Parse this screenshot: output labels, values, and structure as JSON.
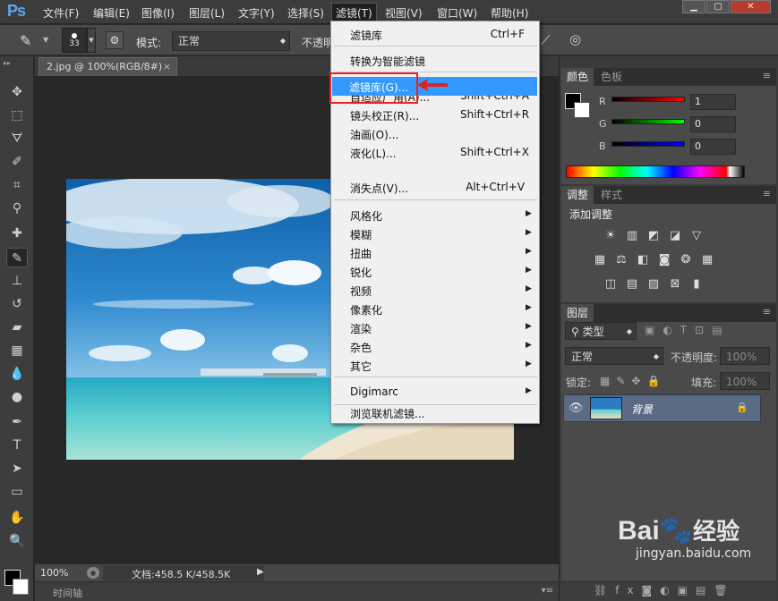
{
  "app": {
    "logo": "Ps"
  },
  "menubar": {
    "items": [
      "文件(F)",
      "编辑(E)",
      "图像(I)",
      "图层(L)",
      "文字(Y)",
      "选择(S)",
      "滤镜(T)",
      "视图(V)",
      "窗口(W)",
      "帮助(H)"
    ],
    "active": "滤镜(T)"
  },
  "options_bar": {
    "brush_size": "33",
    "mode_label": "模式:",
    "mode_value": "正常",
    "opacity_label": "不透明"
  },
  "document": {
    "tab_title": "2.jpg @ 100%(RGB/8#)",
    "close": "×"
  },
  "status": {
    "zoom": "100%",
    "doc_info": "文档:458.5 K/458.5K"
  },
  "timeline": {
    "label": "时间轴"
  },
  "filter_menu": {
    "items": [
      {
        "label": "滤镜库",
        "shortcut": "Ctrl+F"
      },
      {
        "label": "转换为智能滤镜"
      },
      {
        "label": "滤镜库(G)...",
        "highlighted": true
      },
      {
        "label": "自适应广角(A)...",
        "shortcut": "Shift+Ctrl+A"
      },
      {
        "label": "镜头校正(R)...",
        "shortcut": "Shift+Ctrl+R"
      },
      {
        "label": "液化(L)...",
        "shortcut": "Shift+Ctrl+X"
      },
      {
        "label": "油画(O)..."
      },
      {
        "label": "消失点(V)...",
        "shortcut": "Alt+Ctrl+V"
      },
      {
        "label": "风格化",
        "submenu": true
      },
      {
        "label": "模糊",
        "submenu": true
      },
      {
        "label": "扭曲",
        "submenu": true
      },
      {
        "label": "锐化",
        "submenu": true
      },
      {
        "label": "视频",
        "submenu": true
      },
      {
        "label": "像素化",
        "submenu": true
      },
      {
        "label": "渲染",
        "submenu": true
      },
      {
        "label": "杂色",
        "submenu": true
      },
      {
        "label": "其它",
        "submenu": true
      },
      {
        "label": "Digimarc",
        "submenu": true
      },
      {
        "label": "浏览联机滤镜..."
      }
    ]
  },
  "color_panel": {
    "tabs": [
      "颜色",
      "色板"
    ],
    "channels": [
      {
        "name": "R",
        "value": "1"
      },
      {
        "name": "G",
        "value": "0"
      },
      {
        "name": "B",
        "value": "0"
      }
    ]
  },
  "adjust_panel": {
    "tabs": [
      "调整",
      "样式"
    ],
    "title": "添加调整"
  },
  "layers_panel": {
    "tab": "图层",
    "kind_label": "类型",
    "blend": "正常",
    "opacity_label": "不透明度:",
    "opacity_value": "100%",
    "lock_label": "锁定:",
    "fill_label": "填充:",
    "fill_value": "100%",
    "layer_name": "背景"
  },
  "watermark": {
    "brand": "Bai",
    "product": "经验",
    "url": "jingyan.baidu.com"
  },
  "colors": {
    "highlight": "#3399ff",
    "annotation": "#e22222"
  }
}
